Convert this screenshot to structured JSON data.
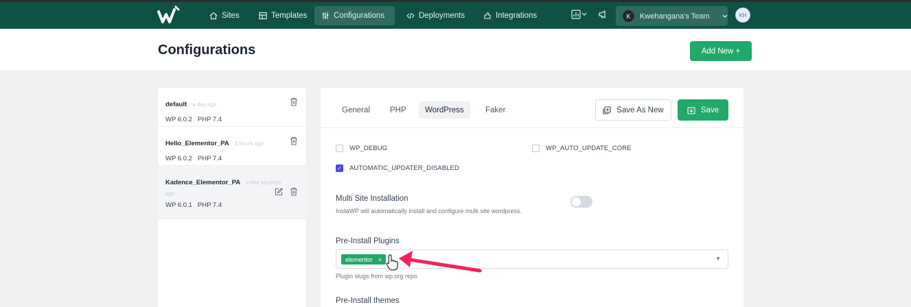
{
  "app": {
    "logo_icon": "instawp-logo-icon",
    "colors": {
      "topbar": "#0f5245",
      "accent": "#22a86a",
      "checkbox": "#4f46e5",
      "annotation": "#f0245a"
    }
  },
  "nav": {
    "items": [
      {
        "label": "Sites",
        "icon": "home-icon"
      },
      {
        "label": "Templates",
        "icon": "template-icon"
      },
      {
        "label": "Configurations",
        "icon": "sliders-icon",
        "active": true
      },
      {
        "label": "Deployments",
        "icon": "code-icon"
      },
      {
        "label": "Integrations",
        "icon": "puzzle-icon"
      }
    ],
    "team_initial": "K",
    "team_name": "Kwehangana's Team",
    "avatar_initials": "KH"
  },
  "header": {
    "title": "Configurations",
    "add_new_label": "Add New +"
  },
  "configs": [
    {
      "name": "default",
      "time": "a day ago",
      "wp": "WP 6.0.2",
      "php": "PHP 7.4"
    },
    {
      "name": "Hello_Elementor_PA",
      "time": "3 hours ago",
      "wp": "WP 6.0.2",
      "php": "PHP 7.4"
    },
    {
      "name": "Kadence_Elementor_PA",
      "time": "a few seconds",
      "time2": "ago",
      "wp": "WP 6.0.1",
      "php": "PHP 7.4",
      "selected": true
    }
  ],
  "panel": {
    "tabs": [
      "General",
      "PHP",
      "WordPress",
      "Faker"
    ],
    "active_tab": "WordPress",
    "save_as_new_label": "Save As New",
    "save_label": "Save",
    "checkboxes": [
      {
        "label": "WP_DEBUG",
        "checked": false
      },
      {
        "label": "WP_AUTO_UPDATE_CORE",
        "checked": false
      },
      {
        "label": "AUTOMATIC_UPDATER_DISABLED",
        "checked": true
      }
    ],
    "multisite": {
      "title": "Multi Site Installation",
      "help": "InstaWP will automatically install and configure multi site wordpress.",
      "enabled": false
    },
    "plugins": {
      "title": "Pre-Install Plugins",
      "chips": [
        "elementor"
      ],
      "chip_remove": "×",
      "help": "Plugin slugs from wp.org repo"
    },
    "themes": {
      "title": "Pre-Install themes"
    }
  }
}
